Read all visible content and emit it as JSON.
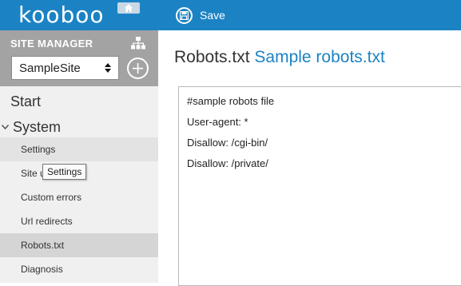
{
  "header": {
    "logo_text": "kooboo",
    "home_icon": "home-icon",
    "save_label": "Save",
    "save_icon": "floppy-disk-icon",
    "accent_color": "#1b83c4"
  },
  "sidebar": {
    "site_manager_title": "SITE MANAGER",
    "sitemap_icon": "sitemap-icon",
    "site_select_value": "SampleSite",
    "add_icon": "plus-circle-icon",
    "start_label": "Start",
    "system_label": "System",
    "system_items": [
      {
        "label": "Settings",
        "state": "hover"
      },
      {
        "label": "Site u",
        "state": "normal"
      },
      {
        "label": "Custom errors",
        "state": "normal"
      },
      {
        "label": "Url redirects",
        "state": "normal"
      },
      {
        "label": "Robots.txt",
        "state": "active"
      },
      {
        "label": "Diagnosis",
        "state": "normal"
      }
    ]
  },
  "tooltip": {
    "text": "Settings"
  },
  "main": {
    "title_prefix": "Robots.txt",
    "title_name": "Sample robots.txt",
    "editor_lines": [
      "#sample robots file",
      "User-agent: *",
      "Disallow: /cgi-bin/",
      "Disallow: /private/"
    ]
  }
}
